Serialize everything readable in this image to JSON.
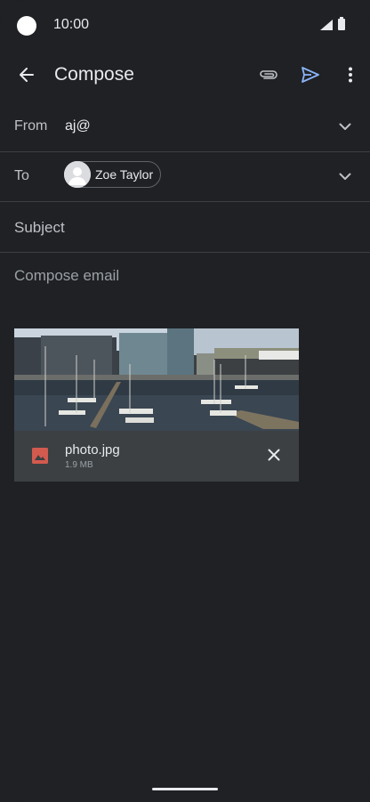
{
  "status_bar": {
    "time": "10:00"
  },
  "app_bar": {
    "title": "Compose",
    "icons": [
      "back-arrow-icon",
      "paperclip-icon",
      "send-icon",
      "more-vert-icon"
    ],
    "send_color": "#8ab4f8"
  },
  "fields": {
    "from_label": "From",
    "from_value": "aj@",
    "to_label": "To",
    "to_chip_name": "Zoe Taylor",
    "subject_placeholder": "Subject",
    "body_placeholder": "Compose email"
  },
  "attachment": {
    "name": "photo.jpg",
    "size": "1.9 MB",
    "icon": "image-file-icon",
    "icon_color": "#d25a4f"
  }
}
